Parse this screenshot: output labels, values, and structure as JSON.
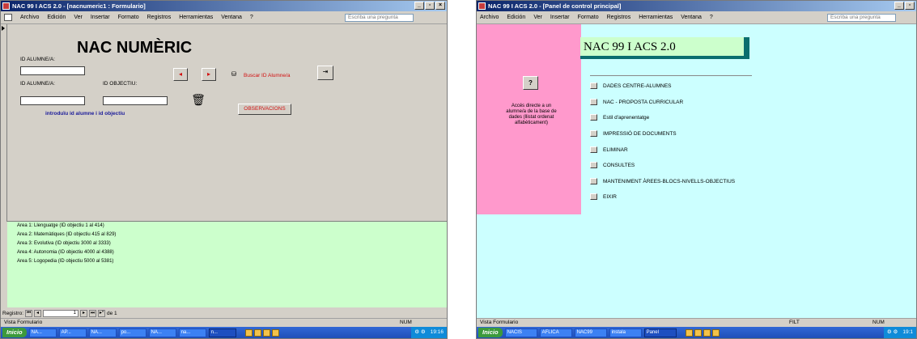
{
  "left_window": {
    "title": "NAC 99 I ACS 2.0 - [nacnumeric1 : Formulario]",
    "menu": [
      "Archivo",
      "Edición",
      "Ver",
      "Insertar",
      "Formato",
      "Registros",
      "Herramientas",
      "Ventana",
      "?"
    ],
    "help_placeholder": "Escriba una pregunta",
    "form_title": "NAC NUMÈRIC",
    "label_id_alumne_top": "ID ALUMNE/A:",
    "label_id_alumne": "ID ALUMNE/A:",
    "label_id_objectiu": "ID OBJECTIU:",
    "id_objectiu_value": "",
    "buscar_label": "Buscar ID Alumne/a",
    "instruction": "introduïu id alumne i id objectiu",
    "observacions_button": "OBSERVACIONS",
    "areas": [
      "Area 1: Llenguatge (ID objectiu 1 al 414)",
      "Area 2: Matemàtiques (ID objectiu 415 al 829)",
      "Area 3: Evolutiva (ID objectiu 3000 al 3333)",
      "Area 4: Autonomia (ID objectiu 4000 al 4388)",
      "Area 5: Logopedia (ID objectiu 5000 al 5381)"
    ],
    "nav_label": "Registro:",
    "nav_current": "1",
    "nav_of": "de 1",
    "status_left": "Vista Formulario",
    "status_right": "NUM",
    "start": "Inicio",
    "tasks": [
      "NA...",
      "AP...",
      "NA...",
      "po...",
      "NA...",
      "na...",
      "n..."
    ],
    "clock": "19:16"
  },
  "right_window": {
    "title": "NAC 99 I ACS 2.0 - [Panel de control principal]",
    "menu": [
      "Archivo",
      "Edición",
      "Ver",
      "Insertar",
      "Formato",
      "Registros",
      "Herramientas",
      "Ventana",
      "?"
    ],
    "help_placeholder": "Escriba una pregunta",
    "panel_title": "NAC 99 I ACS 2.0",
    "help_button": "?",
    "help_text": "Accés directe a un alumne/a de la base de dades (llistat ordenat alfabèticament)",
    "items": [
      "DADES CENTRE-ALUMNES",
      "NAC - PROPOSTA CURRICULAR",
      "Estil d'aprenentatge",
      "IMPRESSIÓ DE DOCUMENTS",
      "ELIMINAR",
      "CONSULTES",
      "MANTENIMENT ÀREES-BLOCS-NIVELLS-OBJECTIUS",
      "EIXIR"
    ],
    "status_left": "Vista Formulario",
    "status_mid": "FILT",
    "status_right": "NUM",
    "start": "Inicio",
    "tasks": [
      "NACIS",
      "AFLICA",
      "NAC99",
      "instala",
      "Panel"
    ],
    "clock": "19:1"
  }
}
